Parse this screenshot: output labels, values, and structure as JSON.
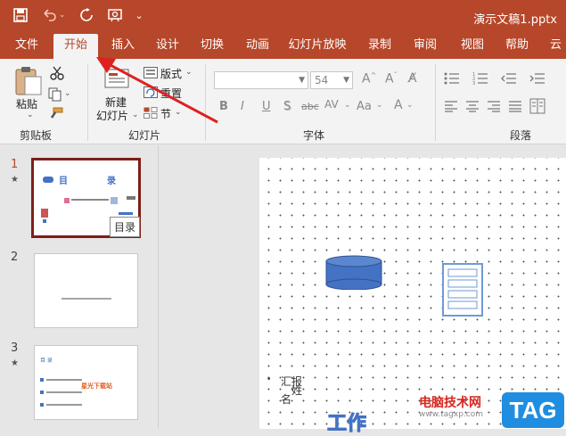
{
  "app": {
    "doc_title": "演示文稿1.pptx"
  },
  "tabs": [
    {
      "label": "文件"
    },
    {
      "label": "开始"
    },
    {
      "label": "插入"
    },
    {
      "label": "设计"
    },
    {
      "label": "切换"
    },
    {
      "label": "动画"
    },
    {
      "label": "幻灯片放映"
    },
    {
      "label": "录制"
    },
    {
      "label": "审阅"
    },
    {
      "label": "视图"
    },
    {
      "label": "帮助"
    },
    {
      "label": "云"
    }
  ],
  "ribbon": {
    "clipboard": {
      "paste": "粘贴",
      "group": "剪贴板"
    },
    "slides": {
      "new_slide_1": "新建",
      "new_slide_2": "幻灯片",
      "layout": "版式",
      "reset": "重置",
      "section": "节",
      "group": "幻灯片"
    },
    "font": {
      "font_name": "",
      "font_size": "54",
      "group": "字体",
      "bold": "B",
      "italic": "I",
      "underline": "U",
      "shadow": "S",
      "strike": "abc",
      "aa": "Aa"
    },
    "paragraph": {
      "group": "段落"
    }
  },
  "thumbnails": [
    {
      "num": "1",
      "star": "★",
      "title_a": "目",
      "title_b": "录"
    },
    {
      "num": "2"
    },
    {
      "num": "3",
      "star": "★",
      "mini_title": "目 录",
      "mini_highlight": "星光下载站"
    }
  ],
  "tooltip": "目录",
  "slide": {
    "text_a": "汇报",
    "text_b": "姓",
    "text_c": "名",
    "text_d": "工作"
  },
  "watermark": {
    "line1": "电脑技术网",
    "line2": "www.tagxp.com",
    "tag": "TAG"
  },
  "colors": {
    "accent": "#b7472a",
    "selected_border": "#7d1f15",
    "shape_fill": "#4472c4"
  }
}
